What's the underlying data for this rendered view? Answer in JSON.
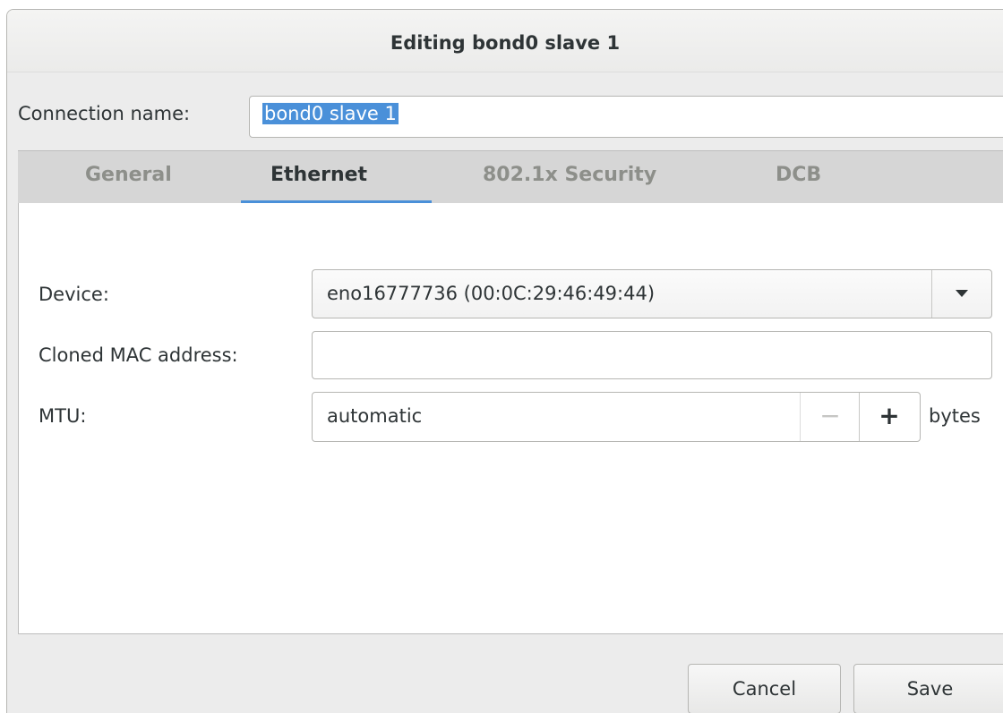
{
  "dialog": {
    "title": "Editing bond0 slave 1"
  },
  "connection": {
    "label": "Connection name:",
    "value": "bond0 slave 1"
  },
  "tabs": [
    {
      "label": "General",
      "active": false
    },
    {
      "label": "Ethernet",
      "active": true
    },
    {
      "label": "802.1x Security",
      "active": false
    },
    {
      "label": "DCB",
      "active": false
    }
  ],
  "ethernet": {
    "device_label": "Device:",
    "device_value": "eno16777736 (00:0C:29:46:49:44)",
    "cloned_mac_label": "Cloned MAC address:",
    "cloned_mac_value": "",
    "mtu_label": "MTU:",
    "mtu_value": "automatic",
    "mtu_unit": "bytes",
    "minus_glyph": "−",
    "plus_glyph": "+"
  },
  "buttons": {
    "cancel": "Cancel",
    "save": "Save"
  },
  "colors": {
    "accent": "#4a90d9",
    "background": "#ececec",
    "text": "#2e3436",
    "inactive_tab_text": "#8d8f8a"
  },
  "icons": {
    "dropdown": "triangle-down-icon"
  }
}
